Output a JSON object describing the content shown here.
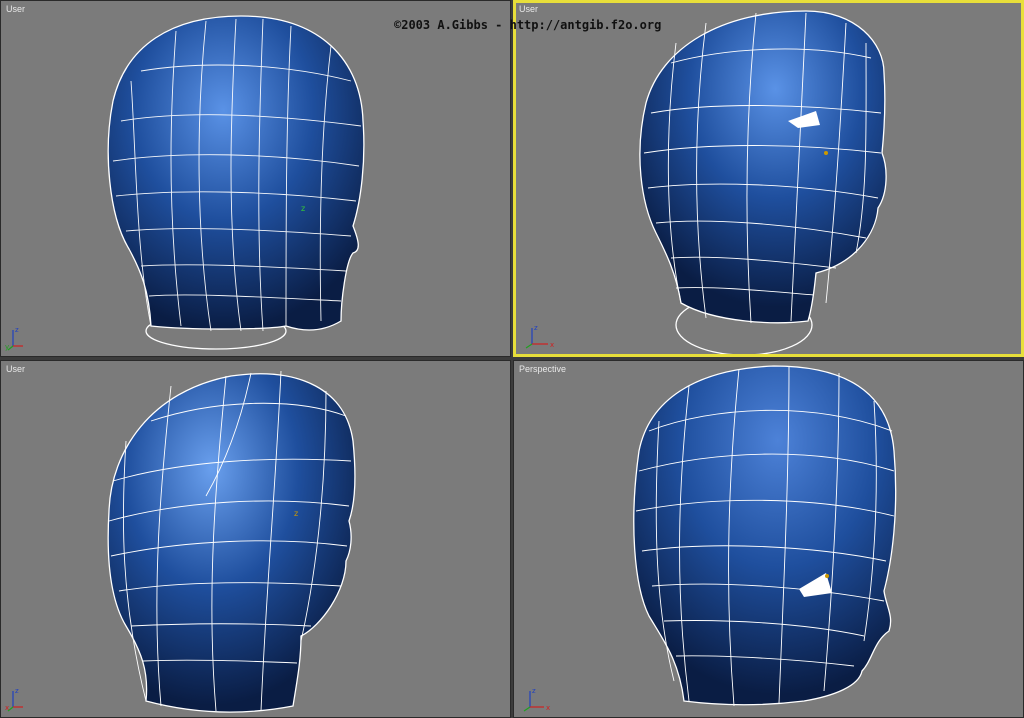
{
  "copyright": "©2003 A.Gibbs - http://antgib.f2o.org",
  "viewports": [
    {
      "label": "User",
      "active": false
    },
    {
      "label": "User",
      "active": true
    },
    {
      "label": "User",
      "active": false
    },
    {
      "label": "Perspective",
      "active": false
    }
  ],
  "axes": {
    "z": "z",
    "x": "x",
    "y": "y"
  },
  "colors": {
    "viewport_bg": "#7b7b7b",
    "active_border": "#e8df3a",
    "mesh_fill": "#1f4f9e",
    "mesh_wire": "#ffffff",
    "axis_x": "#d02020",
    "axis_y": "#20a020",
    "axis_z": "#2040c0"
  },
  "icons": [
    "head-mesh",
    "axis-gizmo",
    "pivot-icon"
  ]
}
